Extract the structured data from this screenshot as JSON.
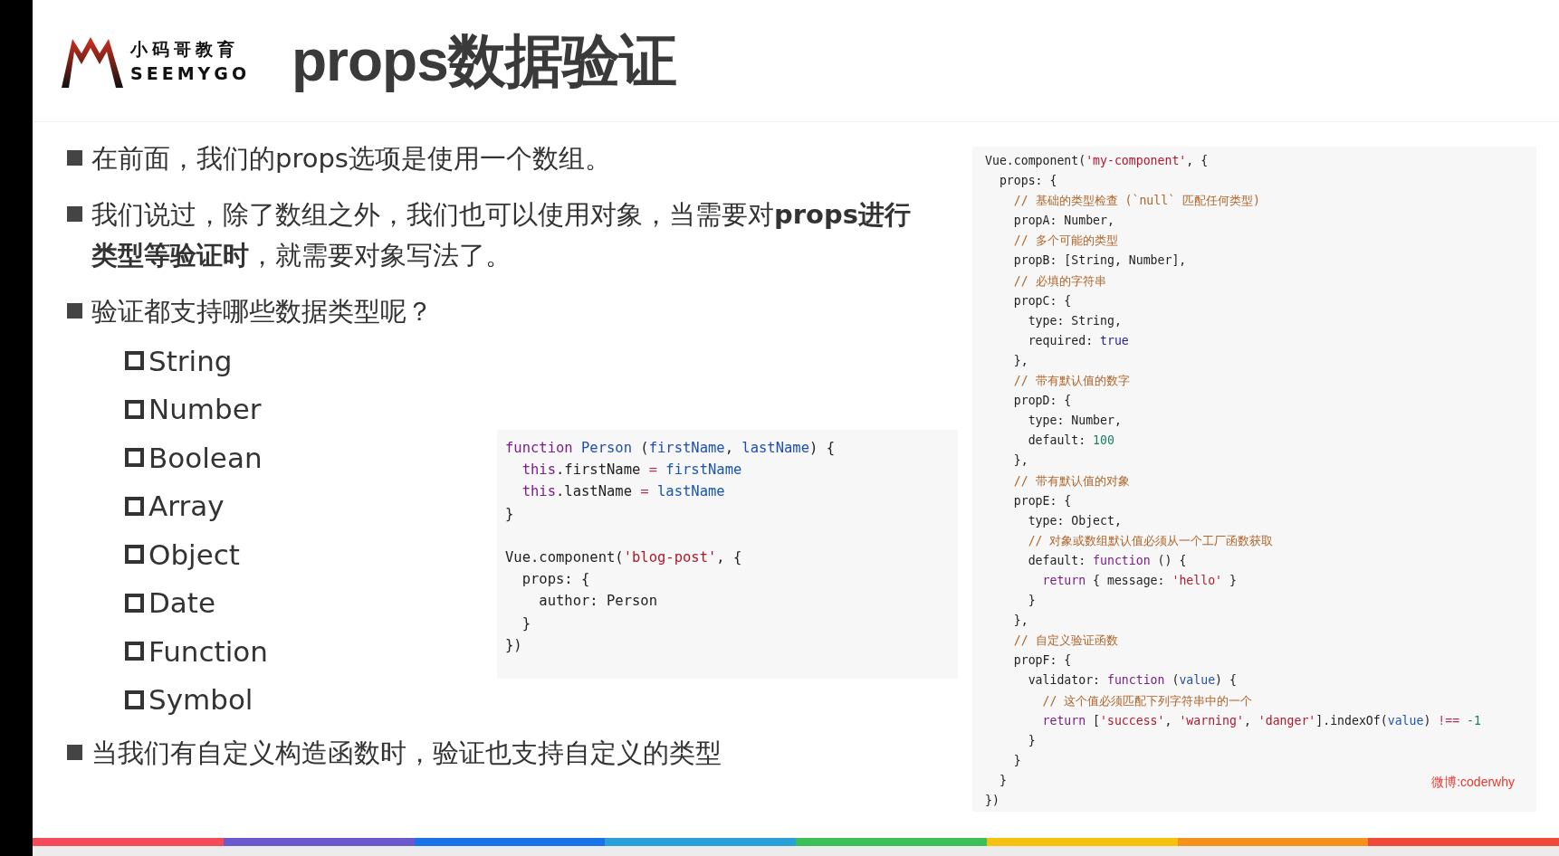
{
  "logo": {
    "name_cn": "小码哥教育",
    "name_en": "SEEMYGO"
  },
  "title": "props数据验证",
  "points": [
    {
      "text": "在前面，我们的props选项是使用一个数组。"
    },
    {
      "text": "我们说过，除了数组之外，我们也可以使用对象，当需要对**props进行类型等验证时**，就需要对象写法了。"
    },
    {
      "text": "验证都支持哪些数据类型呢？"
    }
  ],
  "types": [
    {
      "label": "String"
    },
    {
      "label": "Number"
    },
    {
      "label": "Boolean"
    },
    {
      "label": "Array"
    },
    {
      "label": "Object"
    },
    {
      "label": "Date"
    },
    {
      "label": "Function"
    },
    {
      "label": "Symbol"
    }
  ],
  "example_code": [
    [
      {
        "kind": "keyword",
        "text": "function "
      },
      {
        "kind": "def",
        "text": "Person "
      },
      {
        "kind": "plain",
        "text": "("
      },
      {
        "kind": "def",
        "text": "firstName"
      },
      {
        "kind": "plain",
        "text": ", "
      },
      {
        "kind": "def",
        "text": "lastName"
      },
      {
        "kind": "plain",
        "text": ") {"
      }
    ],
    [
      {
        "kind": "keyword",
        "text": "  this"
      },
      {
        "kind": "plain",
        "text": ".firstName "
      },
      {
        "kind": "operator",
        "text": "= "
      },
      {
        "kind": "variable",
        "text": "firstName"
      }
    ],
    [
      {
        "kind": "keyword",
        "text": "  this"
      },
      {
        "kind": "plain",
        "text": ".lastName "
      },
      {
        "kind": "operator",
        "text": "= "
      },
      {
        "kind": "variable",
        "text": "lastName"
      }
    ],
    [
      {
        "kind": "plain",
        "text": "}"
      }
    ],
    {
      "kind": "blank"
    },
    [
      {
        "kind": "plain",
        "text": "Vue.component("
      },
      {
        "kind": "string",
        "text": "'blog-post'"
      },
      {
        "kind": "plain",
        "text": ", {"
      }
    ],
    [
      {
        "kind": "plain",
        "text": "  props: {"
      }
    ],
    [
      {
        "kind": "plain",
        "text": "    author: Person"
      }
    ],
    [
      {
        "kind": "plain",
        "text": "  }"
      }
    ],
    [
      {
        "kind": "plain",
        "text": "})"
      }
    ]
  ],
  "validation_code": [
    [
      {
        "kind": "plain",
        "text": "Vue.component("
      },
      {
        "kind": "string",
        "text": "'my-component'"
      },
      {
        "kind": "plain",
        "text": ", {"
      }
    ],
    [
      {
        "kind": "plain",
        "text": "  props: {"
      }
    ],
    [
      {
        "kind": "comment",
        "text": "    // 基础的类型检查 (`null` 匹配任何类型)"
      }
    ],
    [
      {
        "kind": "plain",
        "text": "    propA: Number,"
      }
    ],
    [
      {
        "kind": "comment",
        "text": "    // 多个可能的类型"
      }
    ],
    [
      {
        "kind": "plain",
        "text": "    propB: [String, Number],"
      }
    ],
    [
      {
        "kind": "comment",
        "text": "    // 必填的字符串"
      }
    ],
    [
      {
        "kind": "plain",
        "text": "    propC: {"
      }
    ],
    [
      {
        "kind": "plain",
        "text": "      type: String,"
      }
    ],
    [
      {
        "kind": "plain",
        "text": "      required: "
      },
      {
        "kind": "atom",
        "text": "true"
      }
    ],
    [
      {
        "kind": "plain",
        "text": "    },"
      }
    ],
    [
      {
        "kind": "comment",
        "text": "    // 带有默认值的数字"
      }
    ],
    [
      {
        "kind": "plain",
        "text": "    propD: {"
      }
    ],
    [
      {
        "kind": "plain",
        "text": "      type: Number,"
      }
    ],
    [
      {
        "kind": "plain",
        "text": "      default: "
      },
      {
        "kind": "number",
        "text": "100"
      }
    ],
    [
      {
        "kind": "plain",
        "text": "    },"
      }
    ],
    [
      {
        "kind": "comment",
        "text": "    // 带有默认值的对象"
      }
    ],
    [
      {
        "kind": "plain",
        "text": "    propE: {"
      }
    ],
    [
      {
        "kind": "plain",
        "text": "      type: Object,"
      }
    ],
    [
      {
        "kind": "comment",
        "text": "      // 对象或数组默认值必须从一个工厂函数获取"
      }
    ],
    [
      {
        "kind": "plain",
        "text": "      default: "
      },
      {
        "kind": "keyword",
        "text": "function"
      },
      {
        "kind": "plain",
        "text": " () {"
      }
    ],
    [
      {
        "kind": "keyword",
        "text": "        return"
      },
      {
        "kind": "plain",
        "text": " { message: "
      },
      {
        "kind": "string",
        "text": "'hello'"
      },
      {
        "kind": "plain",
        "text": " }"
      }
    ],
    [
      {
        "kind": "plain",
        "text": "      }"
      }
    ],
    [
      {
        "kind": "plain",
        "text": "    },"
      }
    ],
    [
      {
        "kind": "comment",
        "text": "    // 自定义验证函数"
      }
    ],
    [
      {
        "kind": "plain",
        "text": "    propF: {"
      }
    ],
    [
      {
        "kind": "plain",
        "text": "      validator: "
      },
      {
        "kind": "keyword",
        "text": "function"
      },
      {
        "kind": "plain",
        "text": " ("
      },
      {
        "kind": "def",
        "text": "value"
      },
      {
        "kind": "plain",
        "text": ") {"
      }
    ],
    [
      {
        "kind": "comment",
        "text": "        // 这个值必须匹配下列字符串中的一个"
      }
    ],
    [
      {
        "kind": "keyword",
        "text": "        return"
      },
      {
        "kind": "plain",
        "text": " ["
      },
      {
        "kind": "string",
        "text": "'success'"
      },
      {
        "kind": "plain",
        "text": ", "
      },
      {
        "kind": "string",
        "text": "'warning'"
      },
      {
        "kind": "plain",
        "text": ", "
      },
      {
        "kind": "string",
        "text": "'danger'"
      },
      {
        "kind": "plain",
        "text": "].indexOf("
      },
      {
        "kind": "variable",
        "text": "value"
      },
      {
        "kind": "plain",
        "text": ") "
      },
      {
        "kind": "operator",
        "text": "!== "
      },
      {
        "kind": "number",
        "text": "-1"
      }
    ],
    [
      {
        "kind": "plain",
        "text": "      }"
      }
    ],
    [
      {
        "kind": "plain",
        "text": "    }"
      }
    ],
    [
      {
        "kind": "plain",
        "text": "  }"
      }
    ],
    [
      {
        "kind": "plain",
        "text": "})"
      }
    ]
  ],
  "credit": "微博:coderwhy",
  "closing_point": {
    "text": "当我们有自定义构造函数时，验证也支持自定义的类型"
  }
}
